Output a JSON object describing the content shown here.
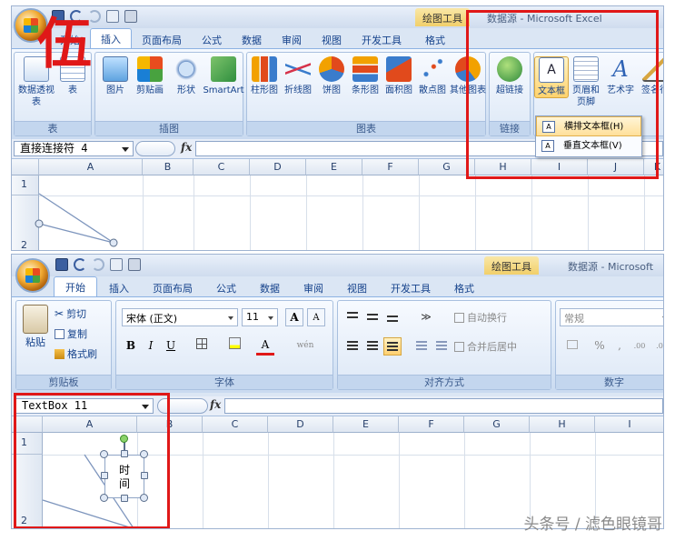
{
  "shot1": {
    "title": "数据源 - Microsoft Excel",
    "context_tab_group": "绘图工具",
    "tabs": [
      "开始",
      "插入",
      "页面布局",
      "公式",
      "数据",
      "审阅",
      "视图",
      "开发工具",
      "格式"
    ],
    "active_tab": "插入",
    "overlay_char": "伍",
    "groups": {
      "table": {
        "label": "表",
        "buttons": [
          "数据透视表",
          "表"
        ]
      },
      "illustrations": {
        "label": "插图",
        "buttons": [
          "图片",
          "剪贴画",
          "形状",
          "SmartArt"
        ]
      },
      "charts": {
        "label": "图表",
        "buttons": [
          "柱形图",
          "折线图",
          "饼图",
          "条形图",
          "面积图",
          "散点图",
          "其他图表"
        ]
      },
      "links": {
        "label": "链接",
        "buttons": [
          "超链接"
        ]
      },
      "text": {
        "buttons": [
          "文本框",
          "页眉和页脚",
          "艺术字",
          "签名行"
        ]
      }
    },
    "textbox_menu": [
      "横排文本框(H)",
      "垂直文本框(V)"
    ],
    "name_box": "直接连接符 4",
    "fx": "fx",
    "columns": [
      "A",
      "B",
      "C",
      "D",
      "E",
      "F",
      "G",
      "H",
      "I",
      "J",
      "K"
    ],
    "rows": [
      "1",
      "2"
    ]
  },
  "shot2": {
    "title": "数据源 - Microsoft",
    "context_tab_group": "绘图工具",
    "tabs": [
      "开始",
      "插入",
      "页面布局",
      "公式",
      "数据",
      "审阅",
      "视图",
      "开发工具",
      "格式"
    ],
    "active_tab": "开始",
    "clipboard": {
      "label": "剪贴板",
      "paste": "粘贴",
      "cut": "剪切",
      "copy": "复制",
      "format_painter": "格式刷"
    },
    "font": {
      "label": "字体",
      "name": "宋体 (正文)",
      "size": "11",
      "grow": "A",
      "shrink": "A",
      "bold": "B",
      "italic": "I",
      "underline": "U",
      "phonetic": "wén"
    },
    "alignment": {
      "label": "对齐方式",
      "wrap": "自动换行",
      "merge": "合并后居中"
    },
    "number": {
      "label": "数字",
      "format": "常规",
      "percent": "%",
      "comma": ",",
      "inc_dec": ".00",
      "dec_dec": ".0"
    },
    "name_box": "TextBox 11",
    "fx": "fx",
    "columns": [
      "A",
      "B",
      "C",
      "D",
      "E",
      "F",
      "G",
      "H",
      "I"
    ],
    "rows": [
      "1",
      "2"
    ],
    "textbox_text": "时\n间"
  },
  "watermark": "头条号 / 滤色眼镜哥",
  "colors": {
    "highlight_red": "#e01818",
    "ribbon_blue": "#15428b",
    "context_yellow": "#f1cf6a"
  }
}
